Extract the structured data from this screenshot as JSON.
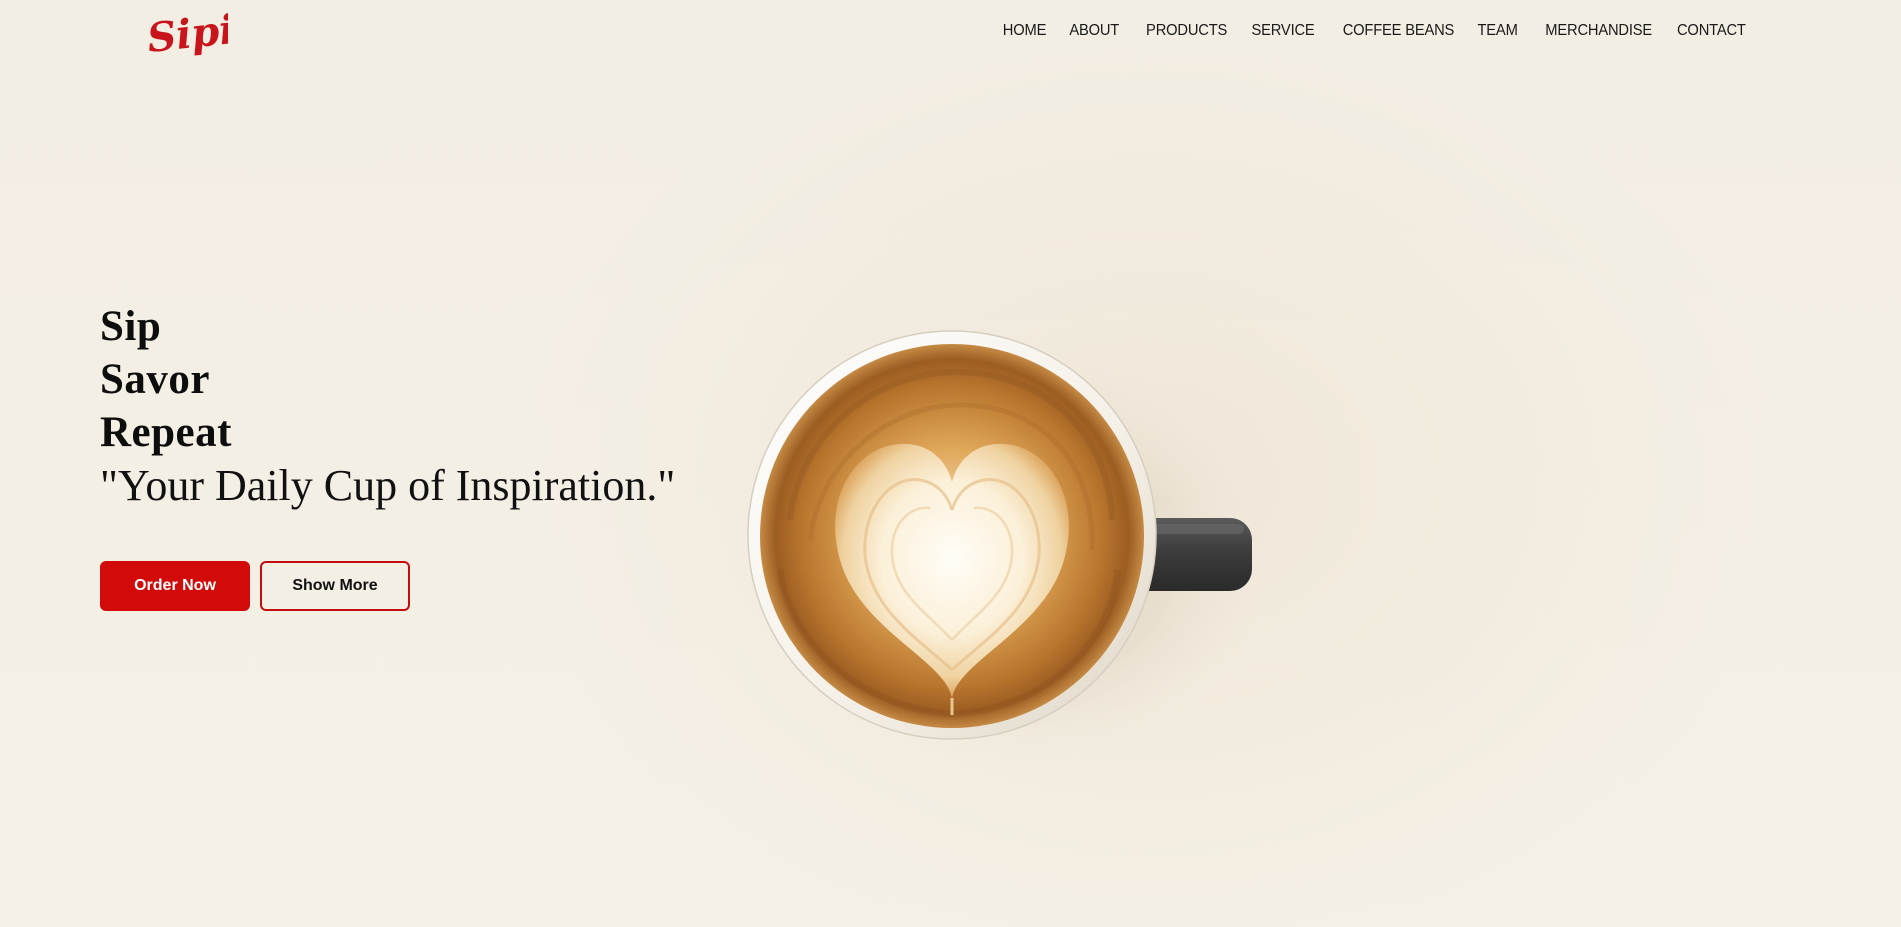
{
  "brand": {
    "logo_text": "Sipio",
    "logo_color": "#c8141a"
  },
  "nav": {
    "items": [
      {
        "label": "HOME"
      },
      {
        "label": "ABOUT"
      },
      {
        "label": "PRODUCTS"
      },
      {
        "label": "SERVICE"
      },
      {
        "label": "COFFEE BEANS"
      },
      {
        "label": "TEAM"
      },
      {
        "label": "MERCHANDISE"
      },
      {
        "label": "CONTACT"
      }
    ]
  },
  "hero": {
    "lines": [
      "Sip",
      "Savor",
      "Repeat"
    ],
    "tagline": "\"Your Daily Cup of Inspiration.\"",
    "primary_button": "Order Now",
    "secondary_button": "Show More",
    "accent_color": "#d20a0a",
    "image": "coffee-cup-latte-art-heart"
  }
}
